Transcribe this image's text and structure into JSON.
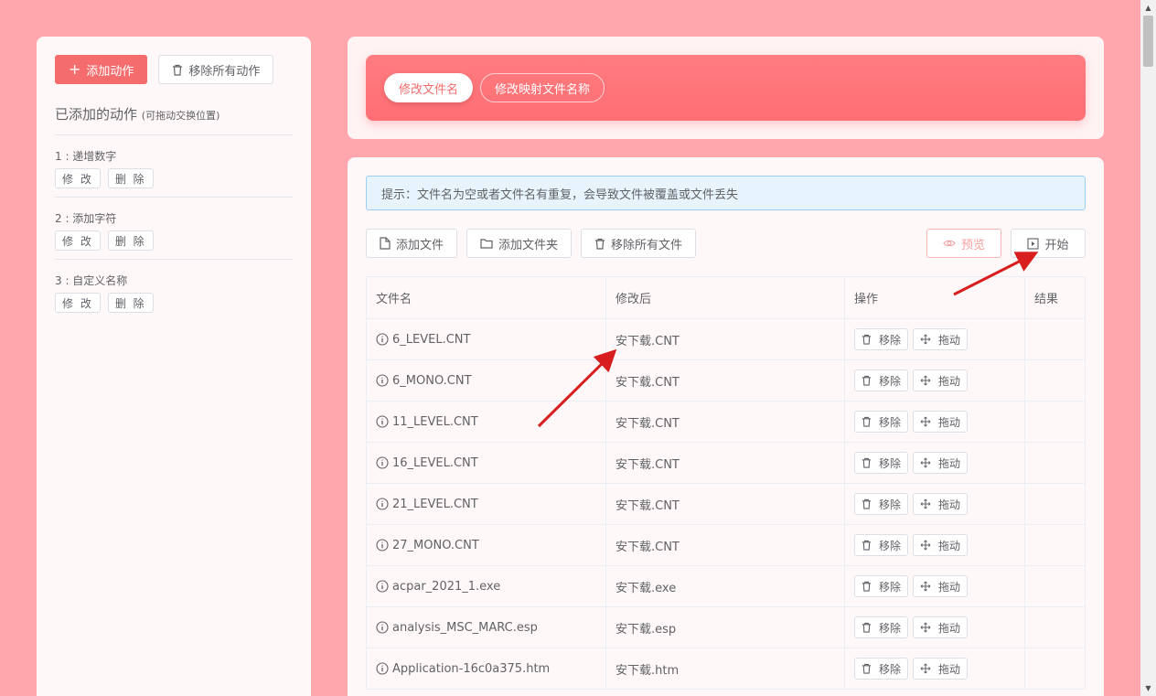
{
  "left": {
    "add_action": "添加动作",
    "remove_all_actions": "移除所有动作",
    "added_title": "已添加的动作",
    "added_hint": "(可拖动交换位置)",
    "edit_label": "修 改",
    "delete_label": "删 除",
    "actions": [
      {
        "label": "1 : 递增数字"
      },
      {
        "label": "2 : 添加字符"
      },
      {
        "label": "3 : 自定义名称"
      }
    ]
  },
  "tabs": [
    {
      "label": "修改文件名",
      "active": true
    },
    {
      "label": "修改映射文件名称",
      "active": false
    }
  ],
  "tip": "提示：文件名为空或者文件名有重复，会导致文件被覆盖或文件丢失",
  "toolbar": {
    "add_file": "添加文件",
    "add_folder": "添加文件夹",
    "remove_all_files": "移除所有文件",
    "preview": "预览",
    "start": "开始"
  },
  "table": {
    "headers": [
      "文件名",
      "修改后",
      "操作",
      "结果"
    ],
    "remove_label": "移除",
    "drag_label": "拖动",
    "rows": [
      {
        "name": "6_LEVEL.CNT",
        "after": "安下载.CNT"
      },
      {
        "name": "6_MONO.CNT",
        "after": "安下载.CNT"
      },
      {
        "name": "11_LEVEL.CNT",
        "after": "安下载.CNT"
      },
      {
        "name": "16_LEVEL.CNT",
        "after": "安下载.CNT"
      },
      {
        "name": "21_LEVEL.CNT",
        "after": "安下载.CNT"
      },
      {
        "name": "27_MONO.CNT",
        "after": "安下载.CNT"
      },
      {
        "name": "acpar_2021_1.exe",
        "after": "安下载.exe"
      },
      {
        "name": "analysis_MSC_MARC.esp",
        "after": "安下载.esp"
      },
      {
        "name": "Application-16c0a375.htm",
        "after": "安下载.htm"
      }
    ]
  },
  "colors": {
    "accent": "#f56c6c",
    "background": "#ffa7ac"
  }
}
